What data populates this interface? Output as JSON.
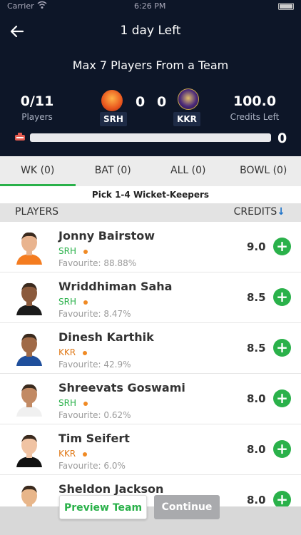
{
  "status_bar": {
    "carrier": "Carrier",
    "time": "6:26 PM"
  },
  "header": {
    "title": "1 day Left",
    "max_players": "Max 7 Players From a Team",
    "players_count": "0/11",
    "players_label": "Players",
    "credits_value": "100.0",
    "credits_label": "Credits Left",
    "team1": {
      "code": "SRH",
      "score": "0"
    },
    "team2": {
      "code": "KKR",
      "score": "0"
    },
    "progress": {
      "selected": "0",
      "fraction": 0
    }
  },
  "tabs": [
    {
      "label": "WK (0)",
      "active": true
    },
    {
      "label": "BAT (0)",
      "active": false
    },
    {
      "label": "ALL (0)",
      "active": false
    },
    {
      "label": "BOWL (0)",
      "active": false
    }
  ],
  "pick_hint": "Pick 1-4 Wicket-Keepers",
  "columns": {
    "players": "PLAYERS",
    "credits": "CREDITS",
    "sort_icon": "↓"
  },
  "players": [
    {
      "name": "Jonny Bairstow",
      "team": "SRH",
      "favourite": "Favourite: 88.88%",
      "credits": "9.0",
      "skin": "#e9b48f",
      "shirt": "#f47c20"
    },
    {
      "name": "Wriddhiman Saha",
      "team": "SRH",
      "favourite": "Favourite: 8.47%",
      "credits": "8.5",
      "skin": "#8b5a3c",
      "shirt": "#1b1b1b"
    },
    {
      "name": "Dinesh Karthik",
      "team": "KKR",
      "favourite": "Favourite: 42.9%",
      "credits": "8.5",
      "skin": "#a06a47",
      "shirt": "#1f4f9c"
    },
    {
      "name": "Shreevats Goswami",
      "team": "SRH",
      "favourite": "Favourite: 0.62%",
      "credits": "8.0",
      "skin": "#c28a64",
      "shirt": "#f0f0f0"
    },
    {
      "name": "Tim Seifert",
      "team": "KKR",
      "favourite": "Favourite: 6.0%",
      "credits": "8.0",
      "skin": "#f0c3a3",
      "shirt": "#111111"
    },
    {
      "name": "Sheldon Jackson",
      "team": "KKR",
      "favourite": "",
      "credits": "8.0",
      "skin": "#e8b68a",
      "shirt": "#f3c318"
    }
  ],
  "colors": {
    "srh": "#2ab14a",
    "kkr": "#e07b1c",
    "accent": "#2ab14a"
  },
  "footer": {
    "preview_label": "Preview Team",
    "continue_label": "Continue"
  }
}
